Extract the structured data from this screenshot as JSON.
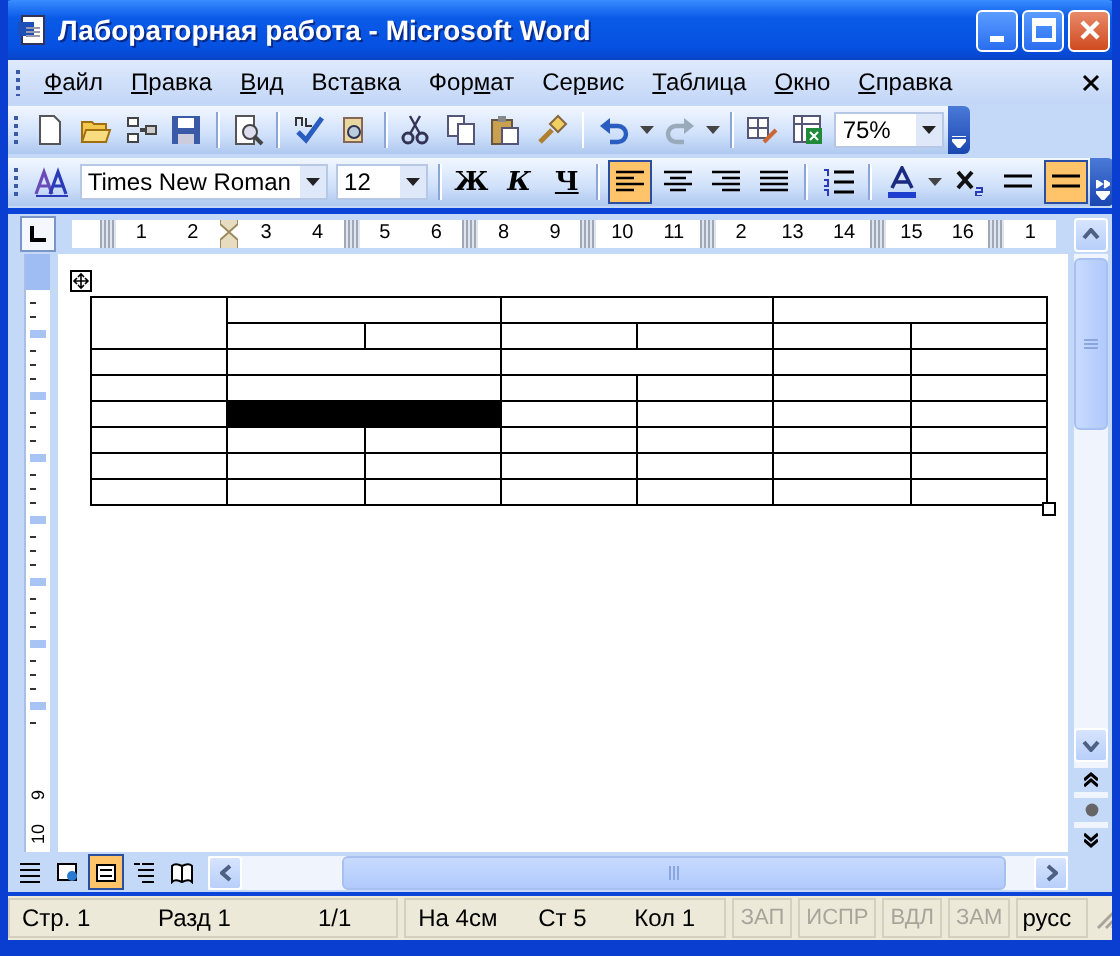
{
  "window": {
    "title": "Лабораторная работа - Microsoft Word"
  },
  "menu": [
    {
      "key": "Ф",
      "after": "айл"
    },
    {
      "key": "П",
      "after": "равка"
    },
    {
      "key": "В",
      "after": "ид"
    },
    {
      "before": "Вст",
      "key": "а",
      "after": "вка"
    },
    {
      "before": "Фор",
      "key": "м",
      "after": "ат"
    },
    {
      "before": "Се",
      "key": "р",
      "after": "вис"
    },
    {
      "key": "Т",
      "after": "аблица"
    },
    {
      "key": "О",
      "after": "кно"
    },
    {
      "key": "С",
      "after": "правка"
    }
  ],
  "standard_toolbar": {
    "zoom": "75%"
  },
  "formatting_toolbar": {
    "font": "Times New Roman",
    "size": "12",
    "bold": "Ж",
    "italic": "К",
    "underline": "Ч",
    "align": [
      {
        "kind": "left",
        "selected": true
      },
      {
        "kind": "center",
        "selected": false
      },
      {
        "kind": "right",
        "selected": false
      },
      {
        "kind": "justify",
        "selected": false
      }
    ],
    "border_selected": true
  },
  "ruler": [
    {
      "kind": "marker"
    },
    {
      "kind": "number",
      "label": "1"
    },
    {
      "kind": "number",
      "label": "2"
    },
    {
      "kind": "indent"
    },
    {
      "kind": "number",
      "label": "3"
    },
    {
      "kind": "number",
      "label": "4"
    },
    {
      "kind": "marker"
    },
    {
      "kind": "number",
      "label": "5"
    },
    {
      "kind": "number",
      "label": "6"
    },
    {
      "kind": "marker"
    },
    {
      "kind": "number",
      "label": "8"
    },
    {
      "kind": "number",
      "label": "9"
    },
    {
      "kind": "marker"
    },
    {
      "kind": "number",
      "label": "10"
    },
    {
      "kind": "number",
      "label": "11"
    },
    {
      "kind": "marker"
    },
    {
      "kind": "number",
      "label": "2"
    },
    {
      "kind": "number",
      "label": "13"
    },
    {
      "kind": "number",
      "label": "14"
    },
    {
      "kind": "marker"
    },
    {
      "kind": "number",
      "label": "15"
    },
    {
      "kind": "number",
      "label": "16"
    },
    {
      "kind": "marker"
    },
    {
      "kind": "number",
      "label": "1"
    }
  ],
  "vertical_ruler": [
    "9",
    "10"
  ],
  "table": {
    "rows": [
      [
        {
          "kind": "tall",
          "selected": false
        },
        {
          "kind": "wide",
          "selected": false
        },
        {
          "kind": "wide",
          "selected": false
        },
        {
          "kind": "wide",
          "selected": false
        }
      ],
      [
        {
          "kind": "cell",
          "selected": false
        },
        {
          "kind": "cell",
          "selected": false
        },
        {
          "kind": "cell",
          "selected": false
        },
        {
          "kind": "cell",
          "selected": false
        },
        {
          "kind": "cell",
          "selected": false
        },
        {
          "kind": "cell",
          "selected": false
        }
      ],
      [
        {
          "kind": "cell",
          "selected": false
        },
        {
          "kind": "wide",
          "selected": false
        },
        {
          "kind": "wide",
          "selected": false
        },
        {
          "kind": "cell",
          "selected": false
        },
        {
          "kind": "cell",
          "selected": false
        }
      ],
      [
        {
          "kind": "cell",
          "selected": false
        },
        {
          "kind": "wide",
          "selected": false
        },
        {
          "kind": "cell",
          "selected": false
        },
        {
          "kind": "cell",
          "selected": false
        },
        {
          "kind": "cell",
          "selected": false
        },
        {
          "kind": "cell",
          "selected": false
        }
      ],
      [
        {
          "kind": "cell",
          "selected": false
        },
        {
          "kind": "wide",
          "selected": true
        },
        {
          "kind": "cell",
          "selected": false
        },
        {
          "kind": "cell",
          "selected": false
        },
        {
          "kind": "cell",
          "selected": false
        },
        {
          "kind": "cell",
          "selected": false
        }
      ],
      [
        {
          "kind": "cell",
          "selected": false
        },
        {
          "kind": "cell",
          "selected": false
        },
        {
          "kind": "cell",
          "selected": false
        },
        {
          "kind": "cell",
          "selected": false
        },
        {
          "kind": "cell",
          "selected": false
        },
        {
          "kind": "cell",
          "selected": false
        },
        {
          "kind": "cell",
          "selected": false
        }
      ],
      [
        {
          "kind": "cell",
          "selected": false
        },
        {
          "kind": "cell",
          "selected": false
        },
        {
          "kind": "cell",
          "selected": false
        },
        {
          "kind": "cell",
          "selected": false
        },
        {
          "kind": "cell",
          "selected": false
        },
        {
          "kind": "cell",
          "selected": false
        },
        {
          "kind": "cell",
          "selected": false
        }
      ],
      [
        {
          "kind": "cell",
          "selected": false
        },
        {
          "kind": "cell",
          "selected": false
        },
        {
          "kind": "cell",
          "selected": false
        },
        {
          "kind": "cell",
          "selected": false
        },
        {
          "kind": "cell",
          "selected": false
        },
        {
          "kind": "cell",
          "selected": false
        },
        {
          "kind": "cell",
          "selected": false
        }
      ]
    ]
  },
  "view_buttons": [
    {
      "kind": "normal",
      "selected": false
    },
    {
      "kind": "web",
      "selected": false
    },
    {
      "kind": "print",
      "selected": true
    },
    {
      "kind": "outline",
      "selected": false
    },
    {
      "kind": "reading",
      "selected": false
    }
  ],
  "status_bar": {
    "fields": [
      {
        "label": "Стр. 1",
        "kind": "page"
      },
      {
        "label": "Разд 1",
        "kind": "section"
      },
      {
        "label": "1/1",
        "kind": "count"
      },
      {
        "label": "На 4см",
        "kind": "at"
      },
      {
        "label": "Ст 5",
        "kind": "line"
      },
      {
        "label": "Кол 1",
        "kind": "col"
      }
    ],
    "modes": [
      {
        "label": "ЗАП",
        "disabled": true
      },
      {
        "label": "ИСПР",
        "disabled": true
      },
      {
        "label": "ВДЛ",
        "disabled": true
      },
      {
        "label": "ЗАМ",
        "disabled": true
      }
    ],
    "language": "русс"
  }
}
